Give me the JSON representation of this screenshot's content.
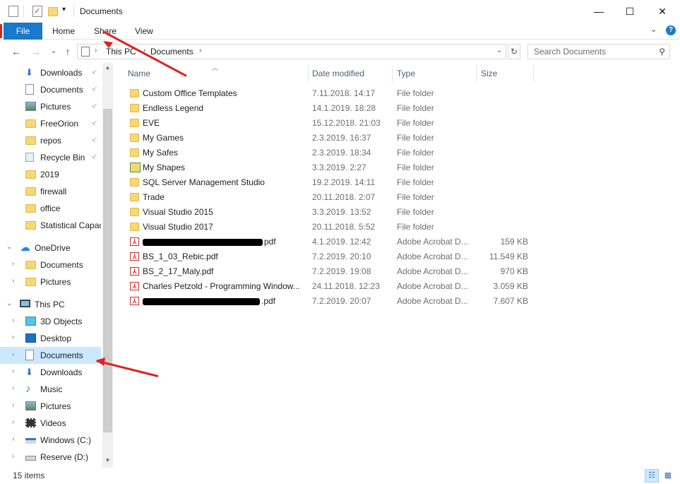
{
  "window": {
    "title": "Documents",
    "minimize": "—",
    "maximize": "☐",
    "close": "✕"
  },
  "ribbon": {
    "file": "File",
    "tabs": [
      "Home",
      "Share",
      "View"
    ],
    "help": "?",
    "expand": "⌄"
  },
  "address": {
    "crumbs": [
      "This PC",
      "Documents"
    ],
    "search_placeholder": "Search Documents"
  },
  "nav": {
    "quick_access": [
      {
        "label": "Downloads",
        "icon": "download-arrow-icon",
        "pinned": true
      },
      {
        "label": "Documents",
        "icon": "document-icon",
        "pinned": true
      },
      {
        "label": "Pictures",
        "icon": "pictures-icon",
        "pinned": true
      },
      {
        "label": "FreeOrion",
        "icon": "folder-icon",
        "pinned": true
      },
      {
        "label": "repos",
        "icon": "folder-icon",
        "pinned": true
      },
      {
        "label": "Recycle Bin",
        "icon": "recycle-bin-icon",
        "pinned": true
      },
      {
        "label": "2019",
        "icon": "folder-icon",
        "pinned": false
      },
      {
        "label": "firewall",
        "icon": "folder-icon",
        "pinned": false
      },
      {
        "label": "office",
        "icon": "folder-icon",
        "pinned": false
      },
      {
        "label": "Statistical Capac",
        "icon": "folder-icon",
        "pinned": false
      }
    ],
    "onedrive": {
      "label": "OneDrive",
      "children": [
        "Documents",
        "Pictures"
      ]
    },
    "this_pc": {
      "label": "This PC",
      "children": [
        {
          "label": "3D Objects",
          "icon": "3d-objects-icon"
        },
        {
          "label": "Desktop",
          "icon": "desktop-icon"
        },
        {
          "label": "Documents",
          "icon": "document-icon",
          "selected": true
        },
        {
          "label": "Downloads",
          "icon": "download-arrow-icon"
        },
        {
          "label": "Music",
          "icon": "music-note-icon"
        },
        {
          "label": "Pictures",
          "icon": "pictures-icon"
        },
        {
          "label": "Videos",
          "icon": "film-icon"
        },
        {
          "label": "Windows (C:)",
          "icon": "windows-drive-icon"
        },
        {
          "label": "Reserve (D:)",
          "icon": "drive-icon"
        }
      ]
    }
  },
  "columns": {
    "name": "Name",
    "date": "Date modified",
    "type": "Type",
    "size": "Size"
  },
  "files": [
    {
      "name": "Custom Office Templates",
      "date": "7.11.2018. 14:17",
      "type": "File folder",
      "size": "",
      "kind": "folder"
    },
    {
      "name": "Endless Legend",
      "date": "14.1.2019. 18:28",
      "type": "File folder",
      "size": "",
      "kind": "folder"
    },
    {
      "name": "EVE",
      "date": "15.12.2018. 21:03",
      "type": "File folder",
      "size": "",
      "kind": "folder"
    },
    {
      "name": "My Games",
      "date": "2.3.2019. 16:37",
      "type": "File folder",
      "size": "",
      "kind": "folder"
    },
    {
      "name": "My Safes",
      "date": "2.3.2019. 18:34",
      "type": "File folder",
      "size": "",
      "kind": "folder"
    },
    {
      "name": "My Shapes",
      "date": "3.3.2019. 2:27",
      "type": "File folder",
      "size": "",
      "kind": "shapes"
    },
    {
      "name": "SQL Server Management Studio",
      "date": "19.2.2019. 14:11",
      "type": "File folder",
      "size": "",
      "kind": "folder"
    },
    {
      "name": "Trade",
      "date": "20.11.2018. 2:07",
      "type": "File folder",
      "size": "",
      "kind": "folder"
    },
    {
      "name": "Visual Studio 2015",
      "date": "3.3.2019. 13:52",
      "type": "File folder",
      "size": "",
      "kind": "folder"
    },
    {
      "name": "Visual Studio 2017",
      "date": "20.11.2018. 5:52",
      "type": "File folder",
      "size": "",
      "kind": "folder"
    },
    {
      "name": "pdf",
      "date": "4.1.2019. 12:42",
      "type": "Adobe Acrobat D...",
      "size": "159 KB",
      "kind": "pdf",
      "redacted": true
    },
    {
      "name": "BS_1_03_Rebic.pdf",
      "date": "7.2.2019. 20:10",
      "type": "Adobe Acrobat D...",
      "size": "11.549 KB",
      "kind": "pdf"
    },
    {
      "name": "BS_2_17_Maly.pdf",
      "date": "7.2.2019. 19:08",
      "type": "Adobe Acrobat D...",
      "size": "970 KB",
      "kind": "pdf"
    },
    {
      "name": "Charles Petzold - Programming Window...",
      "date": "24.11.2018. 12:23",
      "type": "Adobe Acrobat D...",
      "size": "3.059 KB",
      "kind": "pdf"
    },
    {
      "name": ".pdf",
      "date": "7.2.2019. 20:07",
      "type": "Adobe Acrobat D...",
      "size": "7.607 KB",
      "kind": "pdf",
      "redacted": true
    }
  ],
  "status": {
    "count": "15 items"
  },
  "colors": {
    "accent": "#1979ca",
    "selection": "#cce8ff",
    "annotation_arrow": "#e02020",
    "folder": "#f8d775"
  }
}
